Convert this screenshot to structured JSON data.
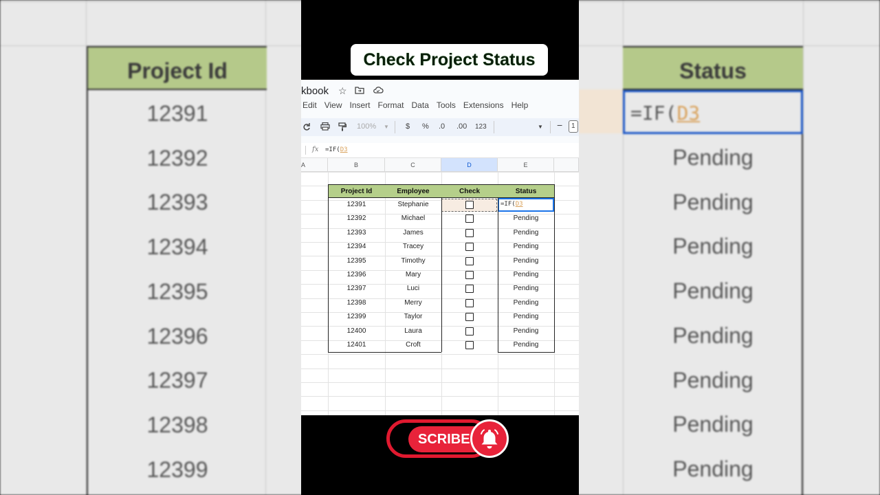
{
  "title": "Check Project Status",
  "background": {
    "left_header": "Project Id",
    "left_values": [
      "12391",
      "12392",
      "12393",
      "12394",
      "12395",
      "12396",
      "12397",
      "12398",
      "12399"
    ],
    "right_header": "Status",
    "right_formula_prefix": "=IF(",
    "right_formula_ref": "D3",
    "right_values": [
      "Pending",
      "Pending",
      "Pending",
      "Pending",
      "Pending",
      "Pending",
      "Pending",
      "Pending"
    ]
  },
  "sheets": {
    "doc_name": "kbook",
    "menu": [
      "Edit",
      "View",
      "Insert",
      "Format",
      "Data",
      "Tools",
      "Extensions",
      "Help"
    ],
    "toolbar": {
      "zoom": "100%",
      "currency": "$",
      "percent": "%",
      "decrease_decimal": ".0",
      "increase_decimal": ".00",
      "number_format": "123",
      "font_size": "1"
    },
    "formula_bar": {
      "fx": "fx",
      "formula_prefix": "=IF(",
      "formula_ref": "D3"
    },
    "columns": [
      "A",
      "B",
      "C",
      "D",
      "E"
    ],
    "table": {
      "headers": [
        "Project Id",
        "Employee",
        "Check",
        "Status"
      ],
      "rows": [
        {
          "id": "12391",
          "employee": "Stephanie",
          "status": ""
        },
        {
          "id": "12392",
          "employee": "Michael",
          "status": "Pending"
        },
        {
          "id": "12393",
          "employee": "James",
          "status": "Pending"
        },
        {
          "id": "12394",
          "employee": "Tracey",
          "status": "Pending"
        },
        {
          "id": "12395",
          "employee": "Timothy",
          "status": "Pending"
        },
        {
          "id": "12396",
          "employee": "Mary",
          "status": "Pending"
        },
        {
          "id": "12397",
          "employee": "Luci",
          "status": "Pending"
        },
        {
          "id": "12398",
          "employee": "Merry",
          "status": "Pending"
        },
        {
          "id": "12399",
          "employee": "Taylor",
          "status": "Pending"
        },
        {
          "id": "12400",
          "employee": "Laura",
          "status": "Pending"
        },
        {
          "id": "12401",
          "employee": "Croft",
          "status": "Pending"
        }
      ],
      "editing_cell": {
        "prefix": "=IF(",
        "ref": "D3"
      }
    }
  },
  "subscribe": {
    "label": "SCRIBE"
  },
  "colors": {
    "header_green": "#b5cf8a",
    "subscribe_red": "#e8233a",
    "selection_blue": "#1a73e8"
  }
}
